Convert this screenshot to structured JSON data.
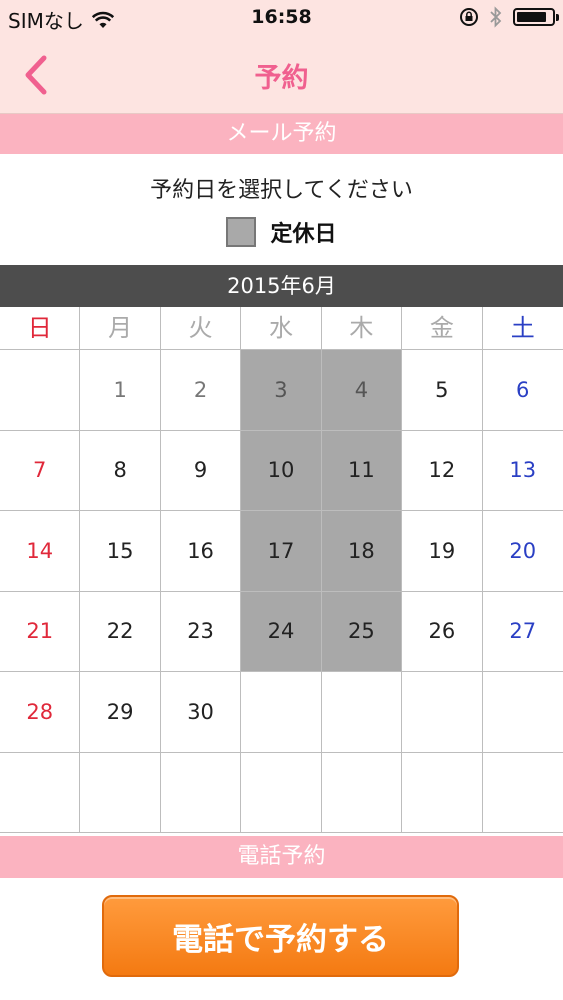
{
  "status": {
    "carrier": "SIMなし",
    "time": "16:58",
    "battery_level": 0.85
  },
  "nav": {
    "title": "予約",
    "back_icon": "chevron-left-icon"
  },
  "mail_section": {
    "title": "メール予約",
    "instruction": "予約日を選択してください",
    "legend_label": "定休日"
  },
  "calendar": {
    "month_label": "2015年6月",
    "weekdays": [
      "日",
      "月",
      "火",
      "水",
      "木",
      "金",
      "土"
    ],
    "weeks": [
      [
        "",
        "1",
        "2",
        "3",
        "4",
        "5",
        "6"
      ],
      [
        "7",
        "8",
        "9",
        "10",
        "11",
        "12",
        "13"
      ],
      [
        "14",
        "15",
        "16",
        "17",
        "18",
        "19",
        "20"
      ],
      [
        "21",
        "22",
        "23",
        "24",
        "25",
        "26",
        "27"
      ],
      [
        "28",
        "29",
        "30",
        "",
        "",
        "",
        ""
      ],
      [
        "",
        "",
        "",
        "",
        "",
        "",
        ""
      ]
    ],
    "closed_weekdays": [
      "水",
      "木"
    ],
    "colors": {
      "sunday": "#e0283a",
      "saturday": "#2a3fc4",
      "closed": "#a8a8a8"
    }
  },
  "phone_section": {
    "title": "電話予約",
    "call_button_label": "電話で予約する"
  },
  "theme": {
    "accent": "#f0608f",
    "band": "#fbb3c0",
    "header_bg": "#fde4e1",
    "button": "#f47a12"
  }
}
